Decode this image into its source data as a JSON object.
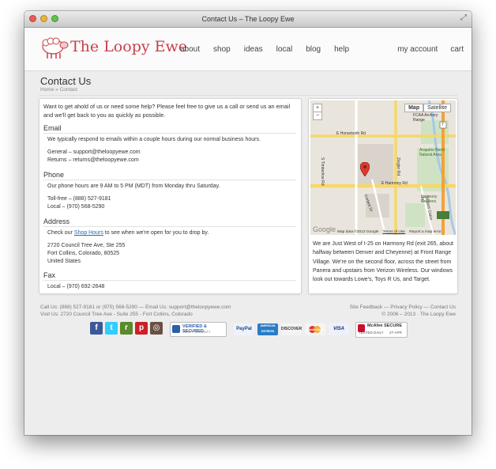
{
  "window": {
    "title": "Contact Us – The Loopy Ewe"
  },
  "header": {
    "logo_text": "The Loopy Ewe",
    "nav": [
      "about",
      "shop",
      "ideas",
      "local",
      "blog",
      "help"
    ],
    "nav_right": [
      "my account",
      "cart"
    ]
  },
  "page": {
    "title": "Contact Us",
    "breadcrumb": "Home  »  Contact"
  },
  "content": {
    "intro": "Want to get ahold of us or need some help? Please feel free to give us a call or send us an email and we'll get back to you as quickly as possible.",
    "email": {
      "heading": "Email",
      "desc": "We typically respond to emails within a couple hours during our normal business hours.",
      "general": "General – support@theloopyewe.com",
      "returns": "Returns – returns@theloopyewe.com"
    },
    "phone": {
      "heading": "Phone",
      "desc": "Our phone hours are 9 AM to 5 PM (MDT) from Monday thru Saturday.",
      "tollfree": "Toll-free – (888) 527-9181",
      "local": "Local – (970) 568-5290"
    },
    "address": {
      "heading": "Address",
      "desc_before": "Check our ",
      "desc_link": "Shop Hours",
      "desc_after": " to see when we're open for you to drop by.",
      "line1": "2720 Council Tree Ave, Ste 255",
      "line2": "Fort Collins, Colorado, 80525",
      "line3": "United States"
    },
    "fax": {
      "heading": "Fax",
      "local": "Local – (970) 692-2648"
    }
  },
  "map": {
    "type_map": "Map",
    "type_satellite": "Satellite",
    "zoom_in": "+",
    "zoom_out": "−",
    "labels": {
      "horsetooth": "E Horsetooth Rd",
      "harmony": "E Harmony Rd",
      "fcaa": "FCAA Archery Range",
      "arapaho": "Arapaho Bend Natural Area",
      "gardens": "Harmony Gardens",
      "timberline": "S Timberline Rd",
      "ziegler": "Ziegler Rd",
      "college": "Corbett Dr",
      "strauss": "Strauss Cabin Rd",
      "rd7": "7"
    },
    "attribution": "Map data ©2013 Google",
    "terms": "Terms of Use",
    "report": "Report a map error",
    "google": "Google",
    "description": "We are Just West of I-25 on Harmony Rd (exit 265, about halfway between Denver and Cheyenne) at Front Range Village. We're on the second floor, across the street from Panera and upstairs from Verizon Wireless. Our windows look out towards Lowe's, Toys R Us, and Target."
  },
  "footer": {
    "left_line1": "Call Us: (888) 527-9181 or (970) 568-5290 — Email Us: support@theloopyewe.com",
    "left_line2": "Visit Us: 2720 Council Tree Ave - Suite 255 - Fort Collins, Colorado",
    "right_line1": "Site Feedback — Privacy Policy — Contact Us",
    "right_line2": "© 2006 – 2013 · The Loopy Ewe"
  },
  "badges": {
    "verified": "VERIFIED & SECURED",
    "verified_sub": "VERIFY SECURITY",
    "paypal": "PayPal",
    "amex": "AMERICAN EXPRESS",
    "discover": "DISCOVER",
    "mastercard": "MasterCard",
    "visa": "VISA",
    "mcafee": "McAfee SECURE",
    "mcafee_sub": "TESTED DAILY",
    "mcafee_date": "27-APR"
  },
  "colors": {
    "accent": "#c6414d",
    "link": "#2a6ab1"
  }
}
